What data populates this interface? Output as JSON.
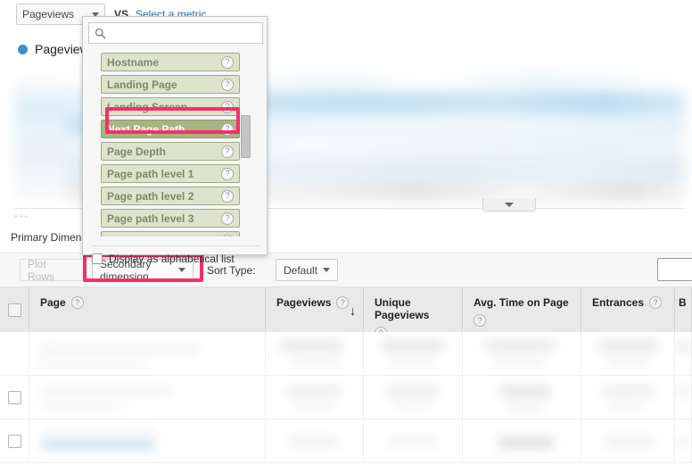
{
  "metric_bar": {
    "metric_select_label": "Pageviews",
    "vs_label": "VS.",
    "select_metric_link": "Select a metric",
    "caret_icon": "chevron-down-icon"
  },
  "legend": {
    "series_label": "Pageviews",
    "dot_color": "#3d8ecc"
  },
  "chart": {
    "ellipsis": "...",
    "collapse_icon": "chevron-down-icon"
  },
  "primary_dimension": {
    "label": "Primary Dimensi"
  },
  "toolbar": {
    "plot_rows_label": "Plot Rows",
    "secondary_dimension_label": "Secondary dimension",
    "sort_type_label": "Sort Type:",
    "sort_type_value": "Default",
    "search_placeholder": ""
  },
  "dropdown": {
    "search_value": "",
    "search_placeholder": "",
    "search_icon": "search-icon",
    "items": [
      {
        "label": "Hostname",
        "selected": false
      },
      {
        "label": "Landing Page",
        "selected": false
      },
      {
        "label": "Landing Screen",
        "selected": false
      },
      {
        "label": "Next Page Path",
        "selected": true
      },
      {
        "label": "Page Depth",
        "selected": false
      },
      {
        "label": "Page path level 1",
        "selected": false
      },
      {
        "label": "Page path level 2",
        "selected": false
      },
      {
        "label": "Page path level 3",
        "selected": false
      },
      {
        "label": "",
        "selected": false
      }
    ],
    "help_icon": "question-mark-icon",
    "footer_checkbox_label": "Display as alphabetical list",
    "footer_checked": false
  },
  "table": {
    "columns": [
      {
        "label": "Page",
        "help": true,
        "sorted": false
      },
      {
        "label": "Pageviews",
        "help": true,
        "sorted": true
      },
      {
        "label": "Unique Pageviews",
        "help": true,
        "sorted": false
      },
      {
        "label": "Avg. Time on Page",
        "help": true,
        "sorted": false
      },
      {
        "label": "Entrances",
        "help": true,
        "sorted": false
      },
      {
        "label": "B",
        "help": false,
        "sorted": false
      }
    ],
    "sort_arrow_icon": "arrow-down-icon",
    "rows": [
      {
        "checked": false
      },
      {
        "checked": false
      },
      {
        "checked": false
      }
    ]
  },
  "annotations": {
    "highlight_color": "#f72f68",
    "next_page_path": "Next Page Path",
    "secondary_dimension": "Secondary dimension"
  }
}
